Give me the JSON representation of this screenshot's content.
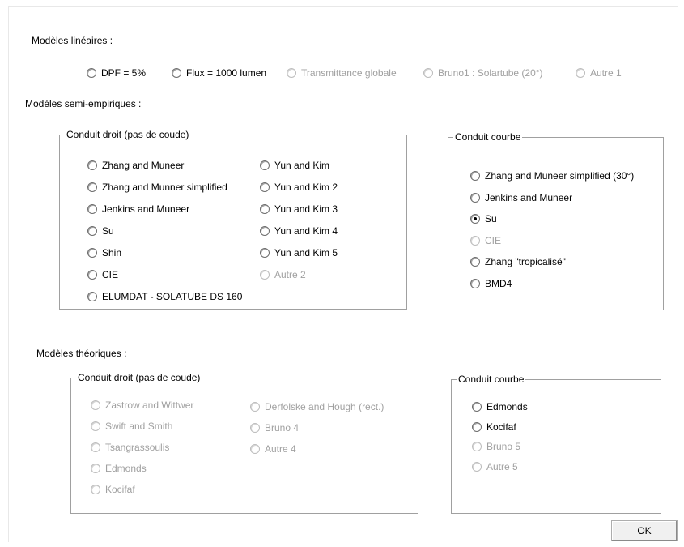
{
  "linear": {
    "title": "Modèles linéaires :",
    "options": [
      {
        "label": "DPF = 5%",
        "checked": false,
        "disabled": false
      },
      {
        "label": "Flux = 1000 lumen",
        "checked": false,
        "disabled": false
      },
      {
        "label": "Transmittance globale",
        "checked": false,
        "disabled": true
      },
      {
        "label": "Bruno1 : Solartube (20°)",
        "checked": false,
        "disabled": true
      },
      {
        "label": "Autre 1",
        "checked": false,
        "disabled": true
      }
    ]
  },
  "semi": {
    "title": "Modèles semi-empiriques :",
    "straight": {
      "legend": "Conduit droit (pas de coude)",
      "col1": [
        {
          "label": "Zhang and Muneer",
          "checked": false,
          "disabled": false
        },
        {
          "label": "Zhang and Munner simplified",
          "checked": false,
          "disabled": false
        },
        {
          "label": "Jenkins and Muneer",
          "checked": false,
          "disabled": false
        },
        {
          "label": "Su",
          "checked": false,
          "disabled": false
        },
        {
          "label": "Shin",
          "checked": false,
          "disabled": false
        },
        {
          "label": "CIE",
          "checked": false,
          "disabled": false
        },
        {
          "label": "ELUMDAT - SOLATUBE DS 160",
          "checked": false,
          "disabled": false
        }
      ],
      "col2": [
        {
          "label": "Yun and Kim",
          "checked": false,
          "disabled": false
        },
        {
          "label": "Yun and Kim 2",
          "checked": false,
          "disabled": false
        },
        {
          "label": "Yun and Kim 3",
          "checked": false,
          "disabled": false
        },
        {
          "label": "Yun and Kim 4",
          "checked": false,
          "disabled": false
        },
        {
          "label": "Yun and Kim 5",
          "checked": false,
          "disabled": false
        },
        {
          "label": "Autre 2",
          "checked": false,
          "disabled": true
        }
      ]
    },
    "curved": {
      "legend": "Conduit courbe",
      "options": [
        {
          "label": "Zhang and Muneer simplified (30°)",
          "checked": false,
          "disabled": false
        },
        {
          "label": "Jenkins and Muneer",
          "checked": false,
          "disabled": false
        },
        {
          "label": "Su",
          "checked": true,
          "disabled": false
        },
        {
          "label": "CIE",
          "checked": false,
          "disabled": true
        },
        {
          "label": "Zhang \"tropicalisé\"",
          "checked": false,
          "disabled": false
        },
        {
          "label": "BMD4",
          "checked": false,
          "disabled": false
        }
      ]
    }
  },
  "theo": {
    "title": "Modèles théoriques :",
    "straight": {
      "legend": "Conduit droit (pas de coude)",
      "col1": [
        {
          "label": "Zastrow and Wittwer",
          "checked": false,
          "disabled": true
        },
        {
          "label": "Swift and Smith",
          "checked": false,
          "disabled": true
        },
        {
          "label": "Tsangrassoulis",
          "checked": false,
          "disabled": true
        },
        {
          "label": "Edmonds",
          "checked": false,
          "disabled": true
        },
        {
          "label": "Kocifaf",
          "checked": false,
          "disabled": true
        }
      ],
      "col2": [
        {
          "label": "Derfolske and Hough (rect.)",
          "checked": false,
          "disabled": true
        },
        {
          "label": "Bruno 4",
          "checked": false,
          "disabled": true
        },
        {
          "label": "Autre 4",
          "checked": false,
          "disabled": true
        }
      ]
    },
    "curved": {
      "legend": "Conduit courbe",
      "options": [
        {
          "label": "Edmonds",
          "checked": false,
          "disabled": false
        },
        {
          "label": "Kocifaf",
          "checked": false,
          "disabled": false
        },
        {
          "label": "Bruno 5",
          "checked": false,
          "disabled": true
        },
        {
          "label": "Autre 5",
          "checked": false,
          "disabled": true
        }
      ]
    }
  },
  "ok_label": "OK"
}
